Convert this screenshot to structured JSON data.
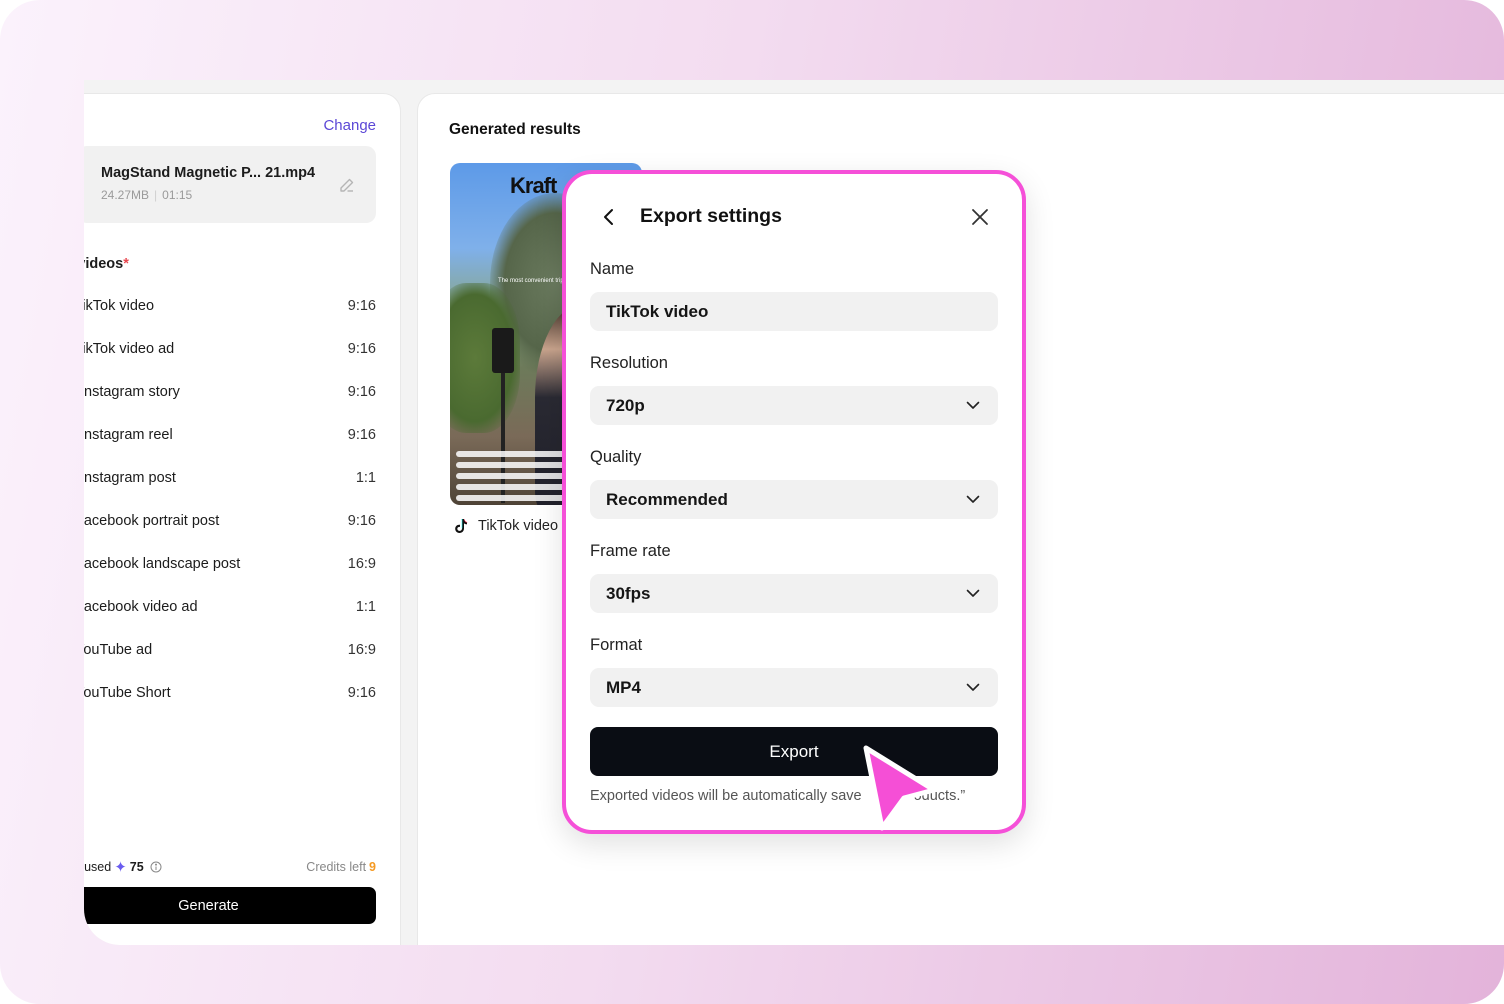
{
  "source": {
    "change_label": "Change",
    "file_name": "MagStand Magnetic P... 21.mp4",
    "file_size": "24.27MB",
    "file_duration": "01:15"
  },
  "platforms": {
    "heading": "Platforms for videos",
    "required_mark": "*",
    "items": [
      {
        "label": "TikTok video",
        "ratio": "9:16"
      },
      {
        "label": "TikTok video ad",
        "ratio": "9:16"
      },
      {
        "label": "Instagram story",
        "ratio": "9:16"
      },
      {
        "label": "Instagram reel",
        "ratio": "9:16"
      },
      {
        "label": "Instagram post",
        "ratio": "1:1"
      },
      {
        "label": "Facebook portrait post",
        "ratio": "9:16"
      },
      {
        "label": "Facebook landscape post",
        "ratio": "16:9"
      },
      {
        "label": "Facebook video ad",
        "ratio": "1:1"
      },
      {
        "label": "YouTube ad",
        "ratio": "16:9"
      },
      {
        "label": "YouTube Short",
        "ratio": "9:16"
      }
    ]
  },
  "credits": {
    "used_label": "Credits used",
    "used_value": "75",
    "left_label": "Credits left",
    "left_value": "9",
    "left_color": "#f59a23"
  },
  "generate_label": "Generate",
  "results": {
    "title": "Generated results",
    "thumbnail": {
      "logo_text": "Kraft",
      "caption": "The most convenient tripod",
      "label": "TikTok video",
      "platform_icon": "tiktok-icon"
    }
  },
  "export_dialog": {
    "title": "Export settings",
    "back_icon": "chevron-left-icon",
    "close_icon": "close-icon",
    "name_label": "Name",
    "name_value": "TikTok video",
    "resolution_label": "Resolution",
    "resolution_value": "720p",
    "quality_label": "Quality",
    "quality_value": "Recommended",
    "frame_rate_label": "Frame rate",
    "frame_rate_value": "30fps",
    "format_label": "Format",
    "format_value": "MP4",
    "export_label": "Export",
    "footnote_visible_start": "Exported videos will be automatically save",
    "footnote_visible_end": "oducts.”",
    "accent_color": "#f550d8"
  }
}
